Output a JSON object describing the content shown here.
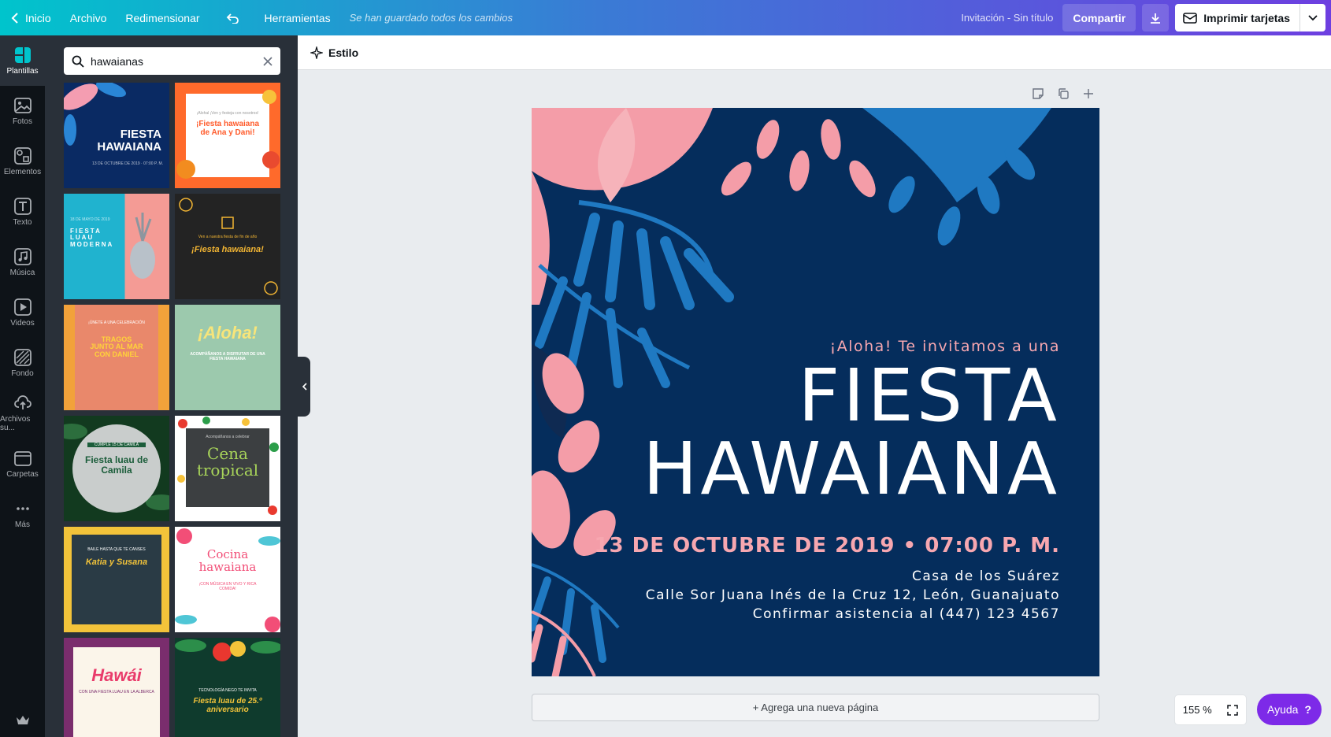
{
  "topbar": {
    "home": "Inicio",
    "file": "Archivo",
    "resize": "Redimensionar",
    "tools": "Herramientas",
    "saved_status": "Se han guardado todos los cambios",
    "doc_title": "Invitación - Sin título",
    "share": "Compartir",
    "print": "Imprimir tarjetas"
  },
  "rail": [
    {
      "label": "Plantillas",
      "icon": "templates-icon"
    },
    {
      "label": "Fotos",
      "icon": "photos-icon"
    },
    {
      "label": "Elementos",
      "icon": "elements-icon"
    },
    {
      "label": "Texto",
      "icon": "text-icon"
    },
    {
      "label": "Música",
      "icon": "music-icon"
    },
    {
      "label": "Videos",
      "icon": "video-icon"
    },
    {
      "label": "Fondo",
      "icon": "background-icon"
    },
    {
      "label": "Archivos su...",
      "icon": "upload-icon"
    },
    {
      "label": "Carpetas",
      "icon": "folder-icon"
    },
    {
      "label": "Más",
      "icon": "more-icon"
    }
  ],
  "search": {
    "value": "hawaianas"
  },
  "templates": [
    {
      "title": "FIESTA\nHAWAIANA",
      "sub": "13 DE OCTUBRE DE 2019 · 07:00 P. M."
    },
    {
      "title": "¡Fiesta hawaiana\nde Ana y Dani!",
      "sub": "¡Alohal ¡Ven y festeja con nosotros!"
    },
    {
      "title": "FIESTA\nLUAU\nMODERNA",
      "sub": "18 DE MAYO DE 2019"
    },
    {
      "title": "¡Fiesta hawaiana!",
      "sub": "Ven a nuestra fiesta de fin de año"
    },
    {
      "title": "TRAGOS\nJUNTO AL MAR\nCON DANIEL",
      "sub": "¡ÚNETE A UNA CELEBRACIÓN"
    },
    {
      "title": "¡Aloha!",
      "sub": "ACOMPÁÑANOS A DISFRUTAR DE UNA FIESTA HAWAIANA"
    },
    {
      "title": "Fiesta luau de\nCamila",
      "sub": "CUMPLE 15 DE CAMILA"
    },
    {
      "title": "Cena\ntropical",
      "sub": "Acompáñanos a celebrar"
    },
    {
      "title": "Katia y Susana",
      "sub": "BAILE HASTA QUE TE CANSES"
    },
    {
      "title": "Cocina\nhawaiana",
      "sub": "¡CON MÚSICA EN VIVO Y RICA COMIDA!"
    },
    {
      "title": "Hawái",
      "sub": "CON UNA FIESTA LUAU EN LA ALBERCA"
    },
    {
      "title": "Fiesta luau de 25.º\naniversario",
      "sub": "TECNOLOGÍA NEGO TE INVITA"
    }
  ],
  "toolbar": {
    "style": "Estilo"
  },
  "canvas": {
    "tagline": "¡Aloha! Te invitamos a una",
    "title_line1": "FIESTA",
    "title_line2": "HAWAIANA",
    "date": "13 DE OCTUBRE DE 2019 • 07:00 P. M.",
    "venue": "Casa de los Suárez",
    "address": "Calle Sor Juana Inés de la Cruz 12, León, Guanajuato",
    "rsvp": "Confirmar asistencia al (447) 123 4567",
    "colors": {
      "background": "#052d5c",
      "accent": "#f7a7b0",
      "leaf_blue": "#1c7fc0"
    }
  },
  "add_page": "+ Agrega una nueva página",
  "zoom": "155 %",
  "help": "Ayuda"
}
